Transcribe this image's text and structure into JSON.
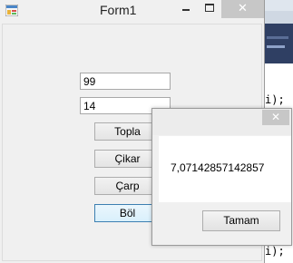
{
  "background_editor": {
    "code_line_1": "i);",
    "code_line_2": "i);"
  },
  "form": {
    "title": "Form1",
    "icon": "form-app-icon",
    "minimize_icon": "minimize-icon",
    "maximize_icon": "maximize-icon",
    "close_icon": "close-icon",
    "close_glyph": "✕",
    "textbox1_value": "99",
    "textbox2_value": "14",
    "buttons": {
      "add": "Topla",
      "subtract": "Çikar",
      "multiply": "Çarp",
      "divide": "Böl"
    }
  },
  "message_box": {
    "text": "7,07142857142857",
    "ok_label": "Tamam",
    "close_glyph": "✕",
    "close_icon": "close-icon"
  },
  "colors": {
    "window_bg": "#f0f0f0",
    "close_button": "#c7c7c7",
    "focused_button_border": "#3c7fb1"
  }
}
